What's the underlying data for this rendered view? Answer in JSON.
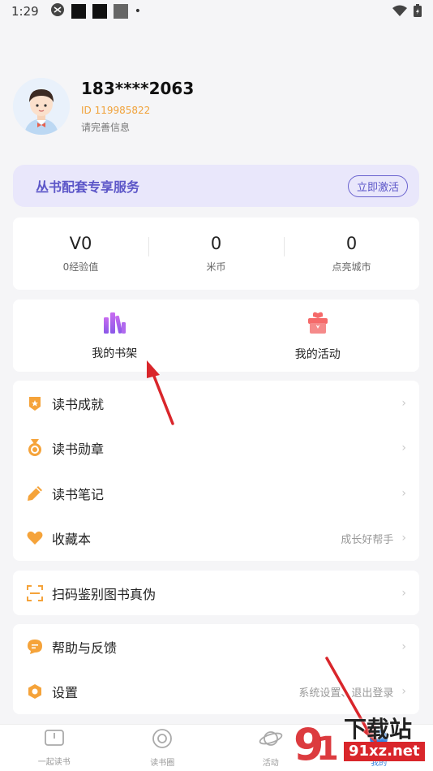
{
  "status_bar": {
    "time": "1:29"
  },
  "profile": {
    "phone": "183****2063",
    "uid": "ID 119985822",
    "complete_info": "请完善信息"
  },
  "vip": {
    "title": "丛书配套专享服务",
    "button": "立即激活"
  },
  "stats": [
    {
      "value": "V0",
      "label": "0经验值"
    },
    {
      "value": "0",
      "label": "米币"
    },
    {
      "value": "0",
      "label": "点亮城市"
    }
  ],
  "quick": [
    {
      "label": "我的书架",
      "icon": "bookshelf-icon"
    },
    {
      "label": "我的活动",
      "icon": "gift-icon"
    }
  ],
  "menu": [
    {
      "label": "读书成就",
      "hint": "",
      "icon": "achievement-icon"
    },
    {
      "label": "读书勋章",
      "hint": "",
      "icon": "medal-icon"
    },
    {
      "label": "读书笔记",
      "hint": "",
      "icon": "pencil-icon"
    },
    {
      "label": "收藏本",
      "hint": "成长好帮手",
      "icon": "heart-icon"
    }
  ],
  "scan": {
    "label": "扫码鉴别图书真伪",
    "icon": "scan-icon"
  },
  "support": [
    {
      "label": "帮助与反馈",
      "hint": "",
      "icon": "chat-icon"
    },
    {
      "label": "设置",
      "hint": "系统设置、退出登录",
      "icon": "settings-icon"
    }
  ],
  "tabs": [
    {
      "label": "一起读书",
      "icon": "book-icon"
    },
    {
      "label": "读书圈",
      "icon": "circle-icon"
    },
    {
      "label": "活动",
      "icon": "planet-icon"
    },
    {
      "label": "我的",
      "icon": "profile-icon"
    }
  ],
  "watermark": {
    "brand": "下载站",
    "domain": "91xz.net"
  },
  "colors": {
    "accent": "#5c56c8",
    "vip_bg": "#e9e7fb",
    "uid": "#f0a23a",
    "icon_orange": "#f5a33a",
    "arrow_red": "#d9262b"
  }
}
